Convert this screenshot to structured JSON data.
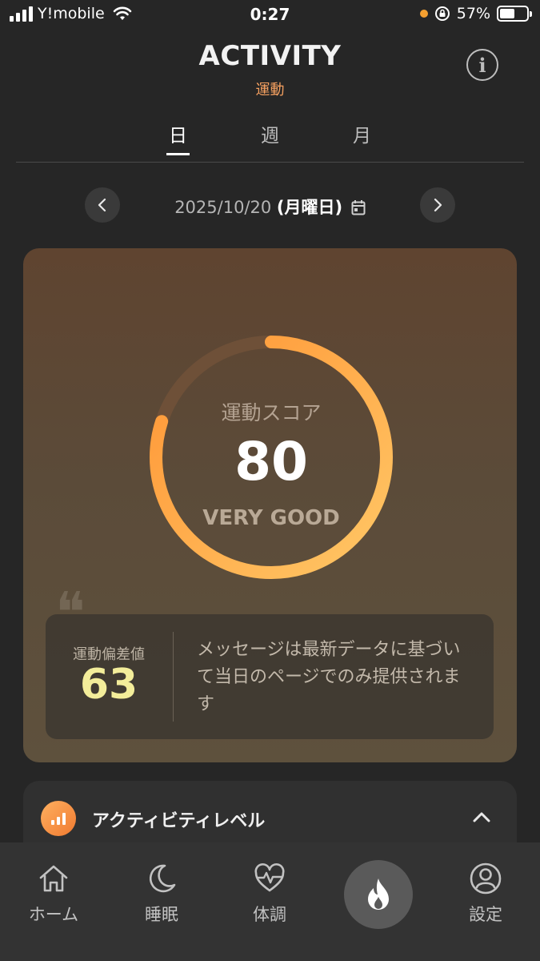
{
  "status_bar": {
    "carrier": "Y!mobile",
    "time": "0:27",
    "battery_percent": "57%",
    "battery_level": 0.57,
    "indicator_color": "#f5a030"
  },
  "header": {
    "title": "ACTIVITY",
    "subtitle": "運動",
    "info_icon": "info-icon"
  },
  "tabs": [
    {
      "label": "日",
      "active": true
    },
    {
      "label": "週",
      "active": false
    },
    {
      "label": "月",
      "active": false
    }
  ],
  "date_nav": {
    "date": "2025/10/20",
    "weekday": "(月曜日)",
    "prev_icon": "chevron-left-icon",
    "next_icon": "chevron-right-icon",
    "calendar_icon": "calendar-icon"
  },
  "score_card": {
    "label": "運動スコア",
    "score": "80",
    "score_fraction": 0.8,
    "rating": "VERY GOOD",
    "deviation_label": "運動偏差値",
    "deviation_value": "63",
    "message": "メッセージは最新データに基づいて当日のページでのみ提供されます",
    "gradient_start": "#ffc766",
    "gradient_end": "#ff9535"
  },
  "activity_level": {
    "title": "アクティビティレベル",
    "icon": "bar-chart-icon",
    "toggle_icon": "chevron-up-icon"
  },
  "bottom_nav": {
    "items": [
      {
        "label": "ホーム",
        "icon": "home-icon"
      },
      {
        "label": "睡眠",
        "icon": "moon-icon"
      },
      {
        "label": "体調",
        "icon": "heart-pulse-icon"
      },
      {
        "label": "",
        "icon": "flame-icon"
      },
      {
        "label": "設定",
        "icon": "user-circle-icon"
      }
    ]
  },
  "colors": {
    "accent": "#f5a060",
    "background": "#262626",
    "deviation": "#f3ed9a"
  }
}
